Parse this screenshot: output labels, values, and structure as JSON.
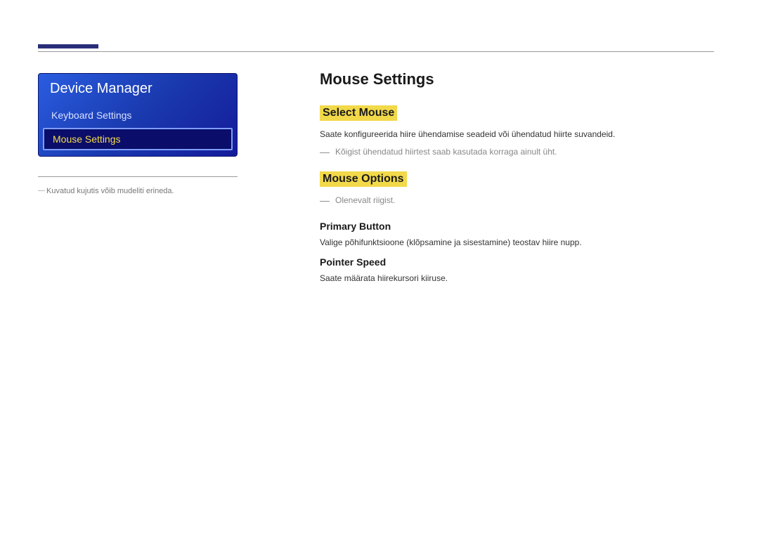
{
  "sidebar": {
    "panel_title": "Device Manager",
    "items": [
      {
        "label": "Keyboard Settings",
        "selected": false
      },
      {
        "label": "Mouse Settings",
        "selected": true
      }
    ],
    "note": "Kuvatud kujutis võib mudeliti erineda."
  },
  "main": {
    "title": "Mouse Settings",
    "sections": [
      {
        "heading": "Select Mouse",
        "body": "Saate konfigureerida hiire ühendamise seadeid või ühendatud hiirte suvandeid.",
        "note": "Kõigist ühendatud hiirtest saab kasutada korraga ainult üht."
      },
      {
        "heading": "Mouse Options",
        "note": "Olenevalt riigist.",
        "subsections": [
          {
            "title": "Primary Button",
            "body": "Valige põhifunktsioone (klõpsamine ja sisestamine) teostav hiire nupp."
          },
          {
            "title": "Pointer Speed",
            "body": "Saate määrata hiirekursori kiiruse."
          }
        ]
      }
    ]
  }
}
